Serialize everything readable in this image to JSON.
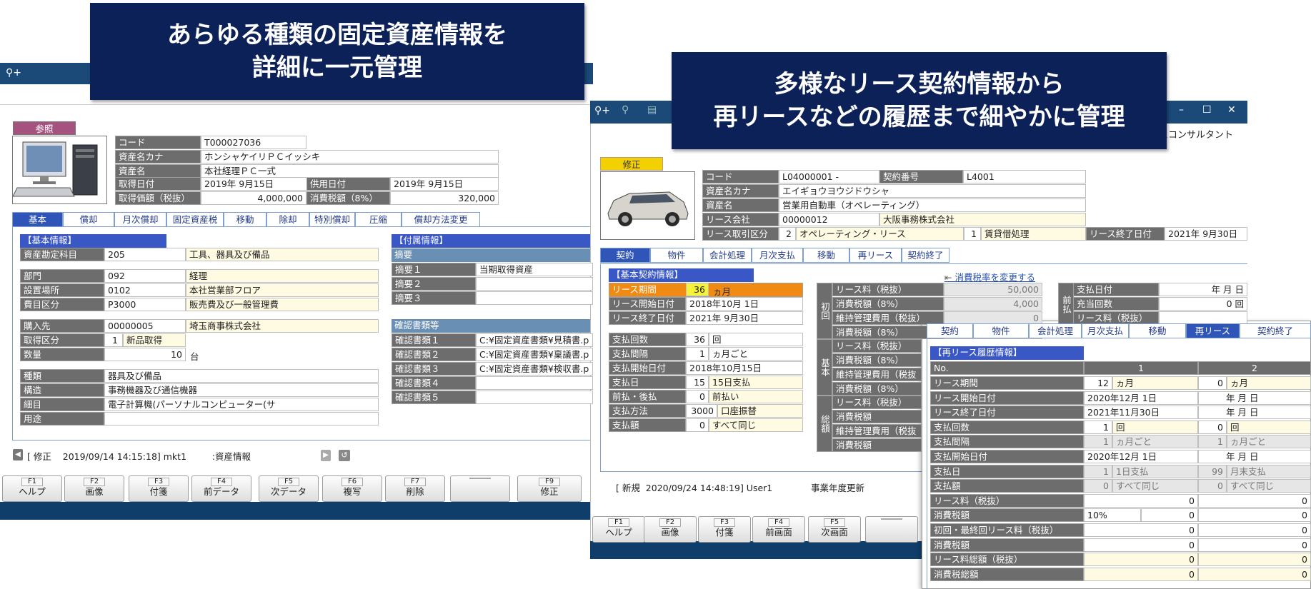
{
  "banners": {
    "left": [
      "あらゆる種類の固定資産情報を",
      "詳細に一元管理"
    ],
    "right": [
      "多様なリース契約情報から",
      "再リースなどの履歴まで細やかに管理"
    ]
  },
  "left": {
    "badge": "参照",
    "header": [
      [
        "コード",
        "T000027036"
      ],
      [
        "資産名カナ",
        "ホンシャケイリＰＣイッシキ"
      ],
      [
        "資産名",
        "本社経理ＰＣ一式"
      ]
    ],
    "acq_date_label": "取得日付",
    "acq_date": "2019年  9月15日",
    "use_date_label": "供用日付",
    "use_date": "2019年  9月15日",
    "acq_amount_label": "取得価額（税抜）",
    "acq_amount": "4,000,000",
    "tax_label": "消費税額（8%）",
    "tax_amount": "320,000",
    "tabs": [
      "基本",
      "償却",
      "月次償却",
      "固定資産税",
      "移動",
      "除却",
      "特別償却",
      "圧縮",
      "償却方法変更"
    ],
    "basic_title": "【基本情報】",
    "basic_rows": [
      [
        "資産勘定科目",
        "205",
        "工具、器具及び備品"
      ],
      [
        "部門",
        "092",
        "経理"
      ],
      [
        "設置場所",
        "0102",
        "本社営業部フロア"
      ],
      [
        "費目区分",
        "P3000",
        "販売費及び一般管理費"
      ],
      [
        "購入先",
        "00000005",
        "埼玉商事株式会社"
      ]
    ],
    "acq_type_label": "取得区分",
    "acq_type_code": "1",
    "acq_type_name": "新品取得",
    "qty_label": "数量",
    "qty": "10",
    "qty_unit": "台",
    "class_rows": [
      [
        "種類",
        "器具及び備品"
      ],
      [
        "構造",
        "事務機器及び通信機器"
      ],
      [
        "細目",
        "電子計算機(パーソナルコンピューター(サ"
      ],
      [
        "用途",
        ""
      ]
    ],
    "attach_title": "【付属情報】",
    "summary_title": "摘要",
    "summary_rows": [
      [
        "摘要１",
        "当期取得資産"
      ],
      [
        "摘要２",
        ""
      ],
      [
        "摘要３",
        ""
      ]
    ],
    "docs_title": "確認書類等",
    "docs_rows": [
      [
        "確認書類１",
        "C:¥固定資産書類¥見積書.p"
      ],
      [
        "確認書類２",
        "C:¥固定資産書類¥稟議書.p"
      ],
      [
        "確認書類３",
        "C:¥固定資産書類¥検収書.p"
      ],
      [
        "確認書類４",
        ""
      ],
      [
        "確認書類５",
        ""
      ]
    ],
    "status": "[ 修正    2019/09/14 14:15:18] mkt1         :資産情報",
    "fkeys": [
      [
        "F1",
        "ヘルプ"
      ],
      [
        "F2",
        "画像"
      ],
      [
        "F3",
        "付箋"
      ],
      [
        "F4",
        "前データ"
      ],
      [
        "F5",
        "次データ"
      ],
      [
        "F6",
        "複写"
      ],
      [
        "F7",
        "削除"
      ],
      [
        "",
        ""
      ],
      [
        "F9",
        "修正"
      ]
    ]
  },
  "right": {
    "company": "スコンサルタント",
    "badge": "修正",
    "code_label": "コード",
    "code": "L04000001  -",
    "contract_no_label": "契約番号",
    "contract_no": "L4001",
    "kana_label": "資産名カナ",
    "kana": "エイギョウヨウジドウシャ",
    "name_label": "資産名",
    "name": "営業用自動車（オペレーティング）",
    "lessor_label": "リース会社",
    "lessor_code": "00000012",
    "lessor_name": "大阪事務株式会社",
    "type_label": "リース取引区分",
    "type_code": "2",
    "type_name": "オペレーティング・リース",
    "type2_code": "1",
    "type2_name": "賃貸借処理",
    "end_label": "リース終了日付",
    "end_date": "2021年  9月30日",
    "tabs": [
      "契約",
      "物件",
      "会計処理",
      "月次支払",
      "移動",
      "再リース",
      "契約終了"
    ],
    "basic_title": "【基本契約情報】",
    "period_label": "リース期間",
    "period": "36",
    "period_unit": "ヵ月",
    "start_label": "リース開始日付",
    "start": "2018年10月  1日",
    "end2_label": "リース終了日付",
    "end2": "2021年  9月30日",
    "pay_rows": [
      [
        "支払回数",
        "36",
        "回"
      ],
      [
        "支払間隔",
        "1",
        "ヵ月ごと"
      ],
      [
        "支払開始日付",
        "2018年10月15日",
        ""
      ],
      [
        "支払日",
        "15",
        "15日支払"
      ],
      [
        "前払・後払",
        "0",
        "前払い"
      ],
      [
        "支払方法",
        "3000",
        "口座振替"
      ],
      [
        "支払額",
        "0",
        "すべて同じ"
      ]
    ],
    "tax_link": "消費税率を変更する",
    "init_group": "初回",
    "init_rows": [
      [
        "リース料（税抜）",
        "50,000"
      ],
      [
        "消費税額（8%）",
        "4,000"
      ],
      [
        "維持管理費用（税抜）",
        "0"
      ],
      [
        "消費税額（8%）",
        ""
      ]
    ],
    "base_group": "基本",
    "base_rows": [
      "リース料（税抜）",
      "消費税額（8%）",
      "維持管理費用（税抜",
      "消費税額（8%）"
    ],
    "total_group": "総額",
    "total_rows": [
      "リース料（税抜）",
      "消費税額",
      "維持管理費用（税抜",
      "消費税額"
    ],
    "prepay_group": "前払",
    "prepay_rows": [
      [
        "支払日付",
        "年  月  日"
      ],
      [
        "充当回数",
        "0  回"
      ],
      [
        "リース料（税抜）",
        ""
      ]
    ],
    "status": "[ 新規  2020/09/24 14:48:19] User1",
    "status2": "事業年度更新",
    "fkeys": [
      [
        "F1",
        "ヘルプ"
      ],
      [
        "F2",
        "画像"
      ],
      [
        "F3",
        "付箋"
      ],
      [
        "F4",
        "前画面"
      ],
      [
        "F5",
        "次画面"
      ],
      [
        "",
        ""
      ]
    ]
  },
  "overlay": {
    "tabs": [
      "契約",
      "物件",
      "会計処理",
      "月次支払",
      "移動",
      "再リース",
      "契約終了"
    ],
    "title": "【再リース履歴情報】",
    "no_label": "No.",
    "col1": "1",
    "col2": "2",
    "rows": [
      [
        "リース期間",
        "12",
        "ヵ月",
        "0",
        "ヵ月"
      ],
      [
        "リース開始日付",
        "2020年12月  1日",
        "",
        "年  月  日",
        ""
      ],
      [
        "リース終了日付",
        "2021年11月30日",
        "",
        "年  月  日",
        ""
      ],
      [
        "支払回数",
        "1",
        "回",
        "0",
        "回"
      ],
      [
        "支払間隔",
        "1",
        "ヵ月ごと",
        "1",
        "ヵ月ごと"
      ],
      [
        "支払開始日付",
        "2020年12月  1日",
        "",
        "年  月  日",
        ""
      ],
      [
        "支払日",
        "1",
        "1日支払",
        "99",
        "月末支払"
      ],
      [
        "支払額",
        "0",
        "すべて同じ",
        "0",
        "すべて同じ"
      ],
      [
        "リース料（税抜）",
        "0",
        "",
        "0",
        ""
      ],
      [
        "消費税額",
        "10%",
        "0",
        "",
        "0"
      ],
      [
        "初回・最終回リース料（税抜）",
        "0",
        "",
        "0",
        ""
      ],
      [
        "消費税額",
        "0",
        "",
        "0",
        ""
      ],
      [
        "リース料総額（税抜）",
        "0",
        "",
        "0",
        ""
      ],
      [
        "消費税総額",
        "0",
        "",
        "0",
        ""
      ]
    ]
  }
}
